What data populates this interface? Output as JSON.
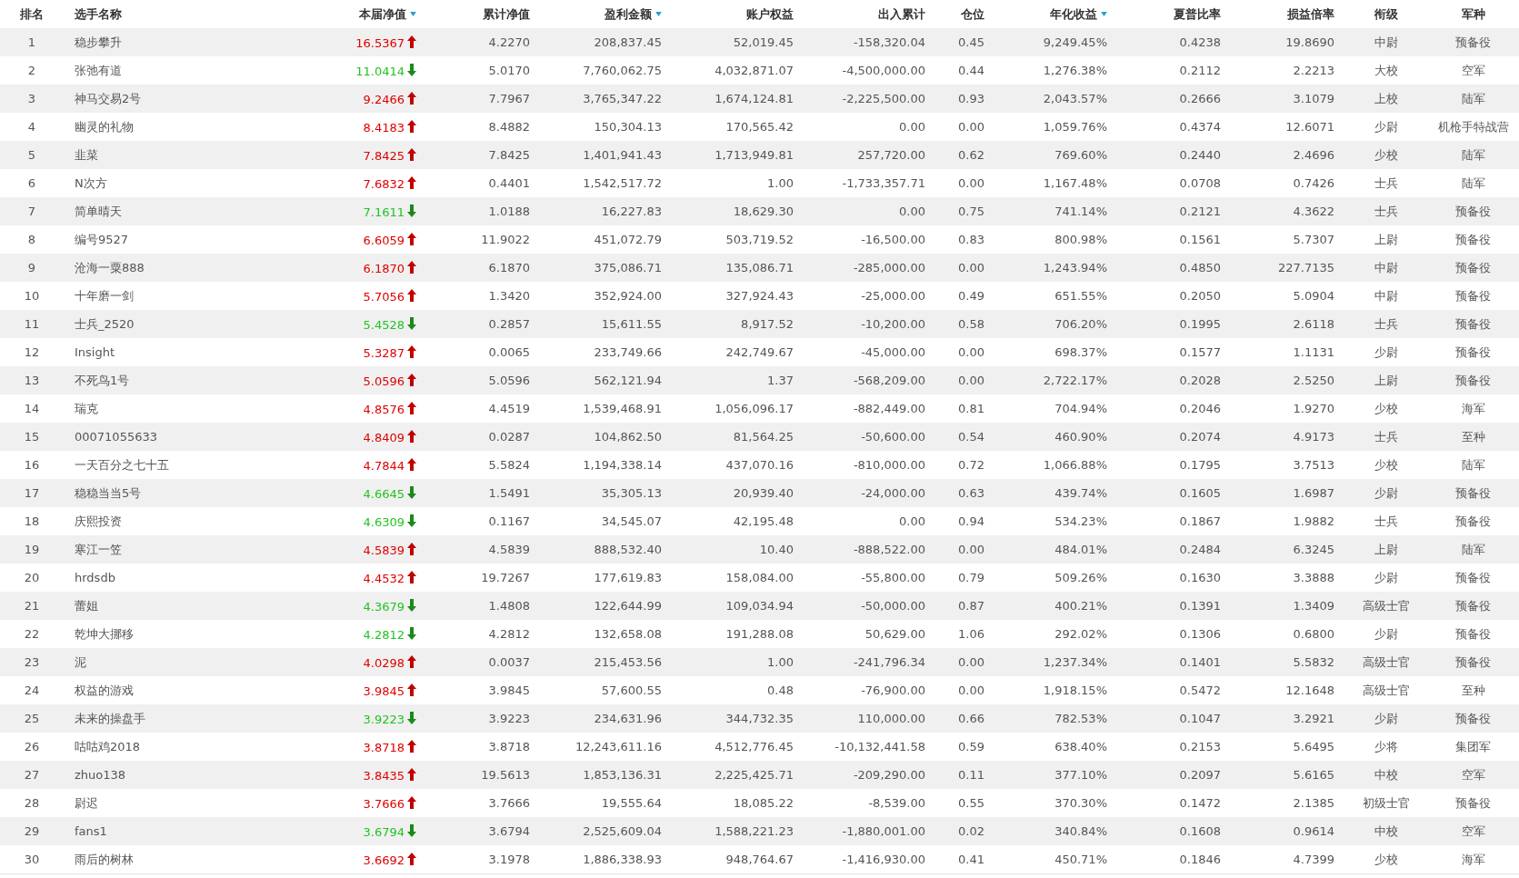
{
  "columns": [
    {
      "label": "排名",
      "kind": "rank",
      "sorted": false
    },
    {
      "label": "选手名称",
      "kind": "text",
      "sorted": false
    },
    {
      "label": "本届净值",
      "kind": "nav",
      "sorted": true
    },
    {
      "label": "累计净值",
      "kind": "number",
      "sorted": false
    },
    {
      "label": "盈利金额",
      "kind": "number",
      "sorted": true
    },
    {
      "label": "账户权益",
      "kind": "number",
      "sorted": false
    },
    {
      "label": "出入累计",
      "kind": "number",
      "sorted": false
    },
    {
      "label": "仓位",
      "kind": "number",
      "sorted": false
    },
    {
      "label": "年化收益",
      "kind": "number",
      "sorted": true
    },
    {
      "label": "夏普比率",
      "kind": "number",
      "sorted": false
    },
    {
      "label": "损益倍率",
      "kind": "number",
      "sorted": false
    },
    {
      "label": "衔级",
      "kind": "center",
      "sorted": false
    },
    {
      "label": "军种",
      "kind": "center",
      "sorted": false
    }
  ],
  "rows": [
    {
      "rising": true,
      "cells": [
        "1",
        "稳步攀升",
        "16.5367",
        "4.2270",
        "208,837.45",
        "52,019.45",
        "-158,320.04",
        "0.45",
        "9,249.45%",
        "0.4238",
        "19.8690",
        "中尉",
        "预备役"
      ]
    },
    {
      "rising": false,
      "cells": [
        "2",
        "张弛有道",
        "11.0414",
        "5.0170",
        "7,760,062.75",
        "4,032,871.07",
        "-4,500,000.00",
        "0.44",
        "1,276.38%",
        "0.2112",
        "2.2213",
        "大校",
        "空军"
      ]
    },
    {
      "rising": true,
      "cells": [
        "3",
        "神马交易2号",
        "9.2466",
        "7.7967",
        "3,765,347.22",
        "1,674,124.81",
        "-2,225,500.00",
        "0.93",
        "2,043.57%",
        "0.2666",
        "3.1079",
        "上校",
        "陆军"
      ]
    },
    {
      "rising": true,
      "cells": [
        "4",
        "幽灵的礼物",
        "8.4183",
        "8.4882",
        "150,304.13",
        "170,565.42",
        "0.00",
        "0.00",
        "1,059.76%",
        "0.4374",
        "12.6071",
        "少尉",
        "机枪手特战营"
      ]
    },
    {
      "rising": true,
      "cells": [
        "5",
        "韭菜",
        "7.8425",
        "7.8425",
        "1,401,941.43",
        "1,713,949.81",
        "257,720.00",
        "0.62",
        "769.60%",
        "0.2440",
        "2.4696",
        "少校",
        "陆军"
      ]
    },
    {
      "rising": true,
      "cells": [
        "6",
        "N次方",
        "7.6832",
        "0.4401",
        "1,542,517.72",
        "1.00",
        "-1,733,357.71",
        "0.00",
        "1,167.48%",
        "0.0708",
        "0.7426",
        "士兵",
        "陆军"
      ]
    },
    {
      "rising": false,
      "cells": [
        "7",
        "简单晴天",
        "7.1611",
        "1.0188",
        "16,227.83",
        "18,629.30",
        "0.00",
        "0.75",
        "741.14%",
        "0.2121",
        "4.3622",
        "士兵",
        "预备役"
      ]
    },
    {
      "rising": true,
      "cells": [
        "8",
        "编号9527",
        "6.6059",
        "11.9022",
        "451,072.79",
        "503,719.52",
        "-16,500.00",
        "0.83",
        "800.98%",
        "0.1561",
        "5.7307",
        "上尉",
        "预备役"
      ]
    },
    {
      "rising": true,
      "cells": [
        "9",
        "沧海一粟888",
        "6.1870",
        "6.1870",
        "375,086.71",
        "135,086.71",
        "-285,000.00",
        "0.00",
        "1,243.94%",
        "0.4850",
        "227.7135",
        "中尉",
        "预备役"
      ]
    },
    {
      "rising": true,
      "cells": [
        "10",
        "十年磨一剑",
        "5.7056",
        "1.3420",
        "352,924.00",
        "327,924.43",
        "-25,000.00",
        "0.49",
        "651.55%",
        "0.2050",
        "5.0904",
        "中尉",
        "预备役"
      ]
    },
    {
      "rising": false,
      "cells": [
        "11",
        "士兵_2520",
        "5.4528",
        "0.2857",
        "15,611.55",
        "8,917.52",
        "-10,200.00",
        "0.58",
        "706.20%",
        "0.1995",
        "2.6118",
        "士兵",
        "预备役"
      ]
    },
    {
      "rising": true,
      "cells": [
        "12",
        "Insight",
        "5.3287",
        "0.0065",
        "233,749.66",
        "242,749.67",
        "-45,000.00",
        "0.00",
        "698.37%",
        "0.1577",
        "1.1131",
        "少尉",
        "预备役"
      ]
    },
    {
      "rising": true,
      "cells": [
        "13",
        "不死鸟1号",
        "5.0596",
        "5.0596",
        "562,121.94",
        "1.37",
        "-568,209.00",
        "0.00",
        "2,722.17%",
        "0.2028",
        "2.5250",
        "上尉",
        "预备役"
      ]
    },
    {
      "rising": true,
      "cells": [
        "14",
        "瑞克",
        "4.8576",
        "4.4519",
        "1,539,468.91",
        "1,056,096.17",
        "-882,449.00",
        "0.81",
        "704.94%",
        "0.2046",
        "1.9270",
        "少校",
        "海军"
      ]
    },
    {
      "rising": true,
      "cells": [
        "15",
        "00071055633",
        "4.8409",
        "0.0287",
        "104,862.50",
        "81,564.25",
        "-50,600.00",
        "0.54",
        "460.90%",
        "0.2074",
        "4.9173",
        "士兵",
        "至种"
      ]
    },
    {
      "rising": true,
      "cells": [
        "16",
        "一天百分之七十五",
        "4.7844",
        "5.5824",
        "1,194,338.14",
        "437,070.16",
        "-810,000.00",
        "0.72",
        "1,066.88%",
        "0.1795",
        "3.7513",
        "少校",
        "陆军"
      ]
    },
    {
      "rising": false,
      "cells": [
        "17",
        "稳稳当当5号",
        "4.6645",
        "1.5491",
        "35,305.13",
        "20,939.40",
        "-24,000.00",
        "0.63",
        "439.74%",
        "0.1605",
        "1.6987",
        "少尉",
        "预备役"
      ]
    },
    {
      "rising": false,
      "cells": [
        "18",
        "庆熙投资",
        "4.6309",
        "0.1167",
        "34,545.07",
        "42,195.48",
        "0.00",
        "0.94",
        "534.23%",
        "0.1867",
        "1.9882",
        "士兵",
        "预备役"
      ]
    },
    {
      "rising": true,
      "cells": [
        "19",
        "寒江一笠",
        "4.5839",
        "4.5839",
        "888,532.40",
        "10.40",
        "-888,522.00",
        "0.00",
        "484.01%",
        "0.2484",
        "6.3245",
        "上尉",
        "陆军"
      ]
    },
    {
      "rising": true,
      "cells": [
        "20",
        "hrdsdb",
        "4.4532",
        "19.7267",
        "177,619.83",
        "158,084.00",
        "-55,800.00",
        "0.79",
        "509.26%",
        "0.1630",
        "3.3888",
        "少尉",
        "预备役"
      ]
    },
    {
      "rising": false,
      "cells": [
        "21",
        "蕾姐",
        "4.3679",
        "1.4808",
        "122,644.99",
        "109,034.94",
        "-50,000.00",
        "0.87",
        "400.21%",
        "0.1391",
        "1.3409",
        "高级士官",
        "预备役"
      ]
    },
    {
      "rising": false,
      "cells": [
        "22",
        "乾坤大挪移",
        "4.2812",
        "4.2812",
        "132,658.08",
        "191,288.08",
        "50,629.00",
        "1.06",
        "292.02%",
        "0.1306",
        "0.6800",
        "少尉",
        "预备役"
      ]
    },
    {
      "rising": true,
      "cells": [
        "23",
        "泥",
        "4.0298",
        "0.0037",
        "215,453.56",
        "1.00",
        "-241,796.34",
        "0.00",
        "1,237.34%",
        "0.1401",
        "5.5832",
        "高级士官",
        "预备役"
      ]
    },
    {
      "rising": true,
      "cells": [
        "24",
        "权益的游戏",
        "3.9845",
        "3.9845",
        "57,600.55",
        "0.48",
        "-76,900.00",
        "0.00",
        "1,918.15%",
        "0.5472",
        "12.1648",
        "高级士官",
        "至种"
      ]
    },
    {
      "rising": false,
      "cells": [
        "25",
        "未来的操盘手",
        "3.9223",
        "3.9223",
        "234,631.96",
        "344,732.35",
        "110,000.00",
        "0.66",
        "782.53%",
        "0.1047",
        "3.2921",
        "少尉",
        "预备役"
      ]
    },
    {
      "rising": true,
      "cells": [
        "26",
        "咕咕鸡2018",
        "3.8718",
        "3.8718",
        "12,243,611.16",
        "4,512,776.45",
        "-10,132,441.58",
        "0.59",
        "638.40%",
        "0.2153",
        "5.6495",
        "少将",
        "集团军"
      ]
    },
    {
      "rising": true,
      "cells": [
        "27",
        "zhuo138",
        "3.8435",
        "19.5613",
        "1,853,136.31",
        "2,225,425.71",
        "-209,290.00",
        "0.11",
        "377.10%",
        "0.2097",
        "5.6165",
        "中校",
        "空军"
      ]
    },
    {
      "rising": true,
      "cells": [
        "28",
        "尉迟",
        "3.7666",
        "3.7666",
        "19,555.64",
        "18,085.22",
        "-8,539.00",
        "0.55",
        "370.30%",
        "0.1472",
        "2.1385",
        "初级士官",
        "预备役"
      ]
    },
    {
      "rising": false,
      "cells": [
        "29",
        "fans1",
        "3.6794",
        "3.6794",
        "2,525,609.04",
        "1,588,221.23",
        "-1,880,001.00",
        "0.02",
        "340.84%",
        "0.1608",
        "0.9614",
        "中校",
        "空军"
      ]
    },
    {
      "rising": true,
      "cells": [
        "30",
        "雨后的树林",
        "3.6692",
        "3.1978",
        "1,886,338.93",
        "948,764.67",
        "-1,416,930.00",
        "0.41",
        "450.71%",
        "0.1846",
        "4.7399",
        "少校",
        "海军"
      ]
    }
  ]
}
